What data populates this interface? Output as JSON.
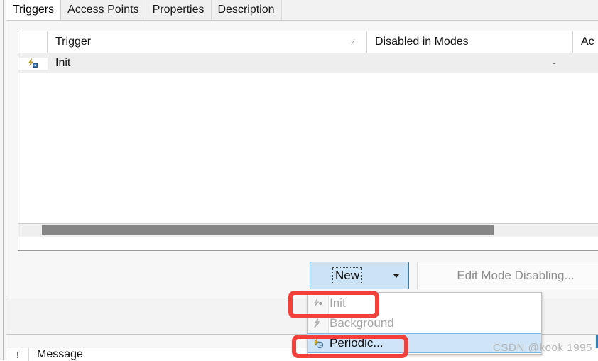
{
  "tabs": [
    {
      "label": "Triggers",
      "active": true
    },
    {
      "label": "Access Points",
      "active": false
    },
    {
      "label": "Properties",
      "active": false
    },
    {
      "label": "Description",
      "active": false
    }
  ],
  "table": {
    "columns": {
      "trigger": "Trigger",
      "disabled_in_modes": "Disabled in Modes",
      "access": "Ac"
    },
    "sort_indicator": "/",
    "rows": [
      {
        "icon": "init-trigger-icon",
        "trigger": "Init",
        "disabled_in_modes": "-",
        "access": ""
      }
    ]
  },
  "toolbar": {
    "new_label": "New",
    "new_arrow": "chevron-down-icon",
    "edit_mode_label": "Edit Mode Disabling..."
  },
  "menu": {
    "items": [
      {
        "label": "Init",
        "icon": "init-trigger-icon",
        "disabled": true,
        "selected": false
      },
      {
        "label": "Background",
        "icon": "background-trigger-icon",
        "disabled": true,
        "selected": false
      },
      {
        "label": "Periodic...",
        "icon": "periodic-trigger-icon",
        "disabled": false,
        "selected": true
      }
    ]
  },
  "lower": {
    "message_column": "Message",
    "message_gutter": "!"
  },
  "watermark": {
    "text": "CSDN @kook 1995"
  },
  "colors": {
    "accent_blue": "#2b7fc4",
    "button_fill": "#cbe3f7",
    "menu_selection": "#cfe5f7",
    "annotation_red": "#f4403a",
    "scrollbar_thumb": "#868686"
  }
}
